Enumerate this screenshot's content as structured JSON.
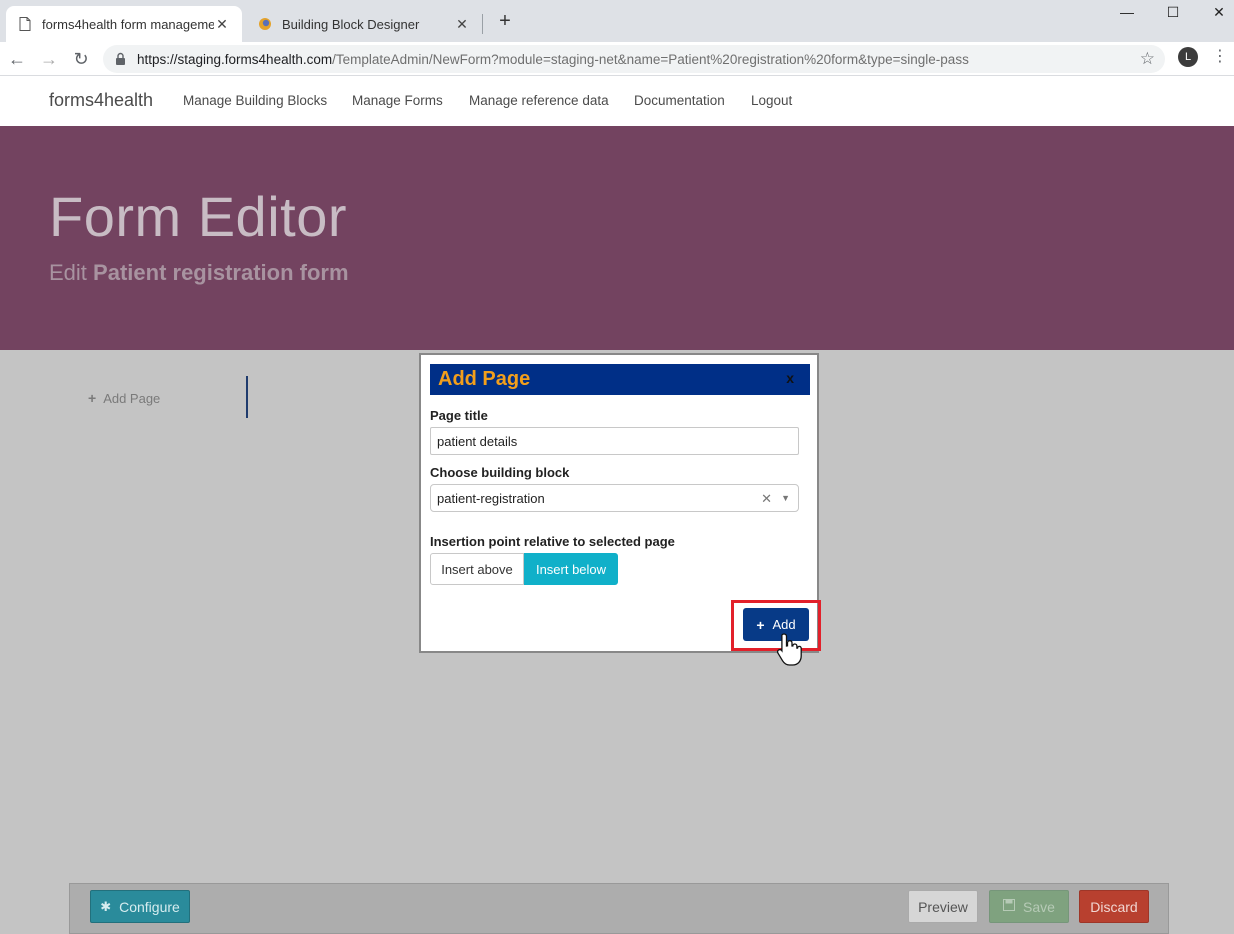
{
  "browser": {
    "tabs": [
      {
        "title": "forms4health form management",
        "close": "✕"
      },
      {
        "title": "Building Block Designer",
        "close": "✕"
      }
    ],
    "new_tab": "+",
    "window_controls": {
      "minimize": "—",
      "maximize": "☐",
      "close": "✕"
    },
    "url_host": "https://staging.forms4health.com",
    "url_rest": "/TemplateAdmin/NewForm?module=staging-net&name=Patient%20registration%20form&type=single-pass",
    "profile_initial": "L"
  },
  "navbar": {
    "brand": "forms4health",
    "links": [
      "Manage Building Blocks",
      "Manage Forms",
      "Manage reference data",
      "Documentation",
      "Logout"
    ]
  },
  "hero": {
    "title": "Form Editor",
    "subtitle_prefix": "Edit",
    "subtitle_name": "Patient registration form"
  },
  "sidebar": {
    "add_page_label": "Add Page"
  },
  "modal": {
    "title": "Add Page",
    "close_label": "x",
    "page_title_label": "Page title",
    "page_title_value": "patient details",
    "building_block_label": "Choose building block",
    "building_block_value": "patient-registration",
    "insertion_label": "Insertion point relative to selected page",
    "insert_above_label": "Insert above",
    "insert_below_label": "Insert below",
    "selected_insertion": "Insert below",
    "add_button_label": "Add"
  },
  "toolbar": {
    "configure_label": "Configure",
    "preview_label": "Preview",
    "save_label": "Save",
    "discard_label": "Discard"
  },
  "colors": {
    "hero_bg": "#734360",
    "modal_header_bg": "#002f87",
    "modal_title": "#f29f1c",
    "insert_below_active": "#10b0c9",
    "add_button": "#073a87",
    "highlight": "#e2202a"
  }
}
